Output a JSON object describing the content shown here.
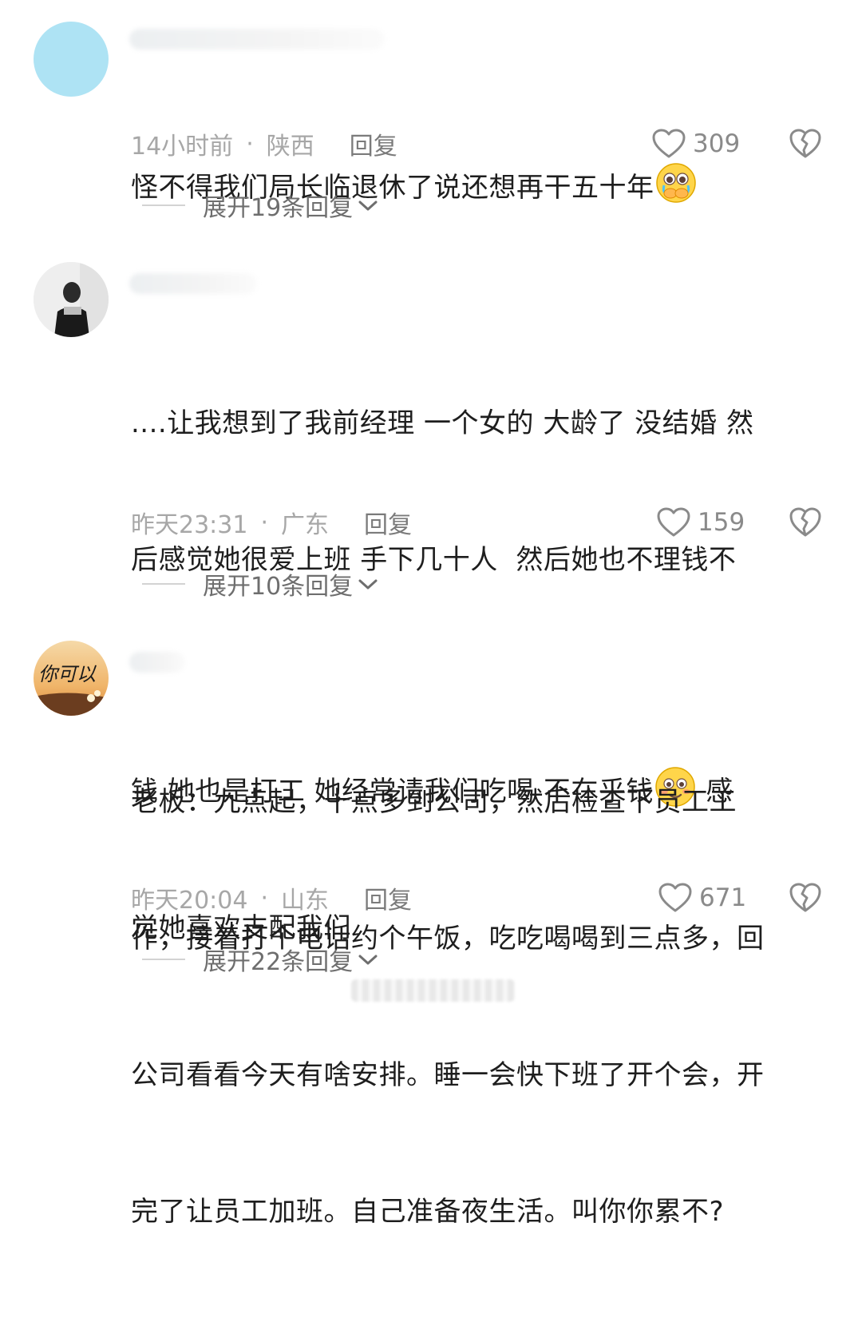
{
  "comments": [
    {
      "text": "怪不得我们局长临退休了说还想再干五十年",
      "text_lines": [
        "怪不得我们局长临退休了说还想再干五十年"
      ],
      "emoji": "crying-holding-back-tears-emoji",
      "time": "14小时前",
      "separator": "·",
      "location": "陕西",
      "reply_label": "回复",
      "likes": "309",
      "expand_label": "展开19条回复"
    },
    {
      "text_lines": [
        "....让我想到了我前经理 一个女的 大龄了 没结婚 然",
        "后感觉她很爱上班 手下几十人  然后她也不理钱不",
        "钱 她也是打工 她经常请我们吃喝 不在乎钱",
        "觉她喜欢支配我们"
      ],
      "inline_after_emoji": " 感",
      "emoji": "blushing-smile-emoji",
      "time": "昨天23:31",
      "separator": "·",
      "location": "广东",
      "reply_label": "回复",
      "likes": "159",
      "expand_label": "展开10条回复"
    },
    {
      "avatar_text": "你可以",
      "text_lines": [
        "老板：九点起，十点多到公司，然后检查下员工工",
        "作，接着打个电话约个午饭，吃吃喝喝到三点多，回",
        "公司看看今天有啥安排。睡一会快下班了开个会，开",
        "完了让员工加班。自己准备夜生活。叫你你累不?"
      ],
      "time": "昨天20:04",
      "separator": "·",
      "location": "山东",
      "reply_label": "回复",
      "likes": "671",
      "expand_label": "展开22条回复"
    }
  ],
  "colors": {
    "meta_gray": "#a7a7a7",
    "text": "#1e1e1e",
    "avatar_blue": "#aee3f4"
  }
}
